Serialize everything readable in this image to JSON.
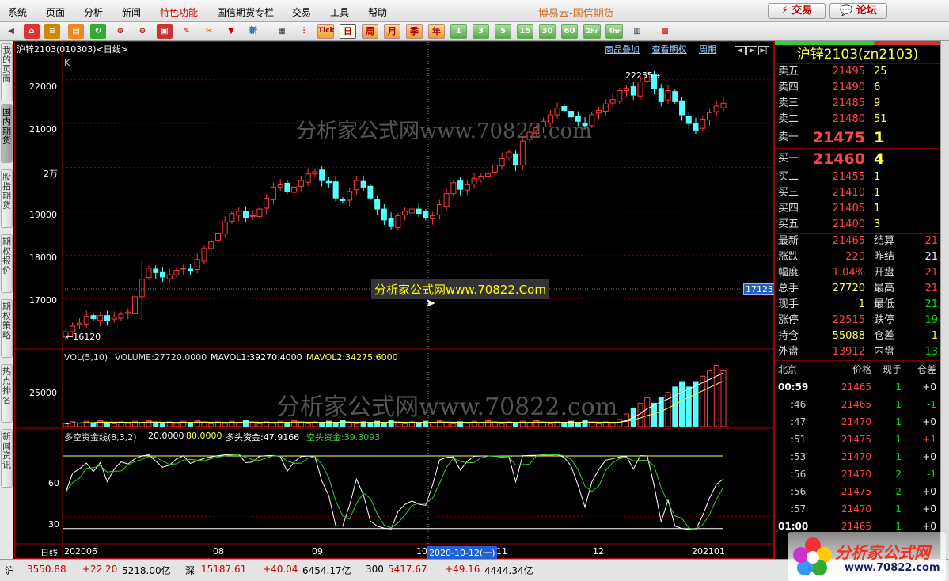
{
  "menu": {
    "items": [
      "系统",
      "页面",
      "分析",
      "新闻",
      "特色功能",
      "国信期货专栏",
      "交易",
      "工具",
      "帮助"
    ],
    "app_title": "博易云-国信期货",
    "trade_btn": "⚡ 交易",
    "forum_btn": "💬 论坛"
  },
  "toolbar": {
    "cycles": [
      "1",
      "3",
      "5",
      "15",
      "30",
      "60",
      "2hr",
      "4hr"
    ],
    "special": [
      "Tick",
      "日",
      "周",
      "月",
      "季",
      "年"
    ]
  },
  "left_tabs": [
    "我的页面",
    "国内期货",
    "股指期货",
    "期权报价",
    "期权策略",
    "热点排名",
    "新闻资讯"
  ],
  "chart": {
    "symbol_info": "沪锌2103(010303)<日线>",
    "k_label": "K",
    "links": [
      "商品叠加",
      "查看期权",
      "周期"
    ],
    "price_axis": [
      "22000",
      "21000",
      "2万",
      "19000",
      "18000",
      "17000"
    ],
    "high_label": "22255→",
    "low_label": "←16120",
    "cursor_price": "17123",
    "watermark": "分析家公式网www.70822.com",
    "tooltip": "分析家公式网www.70822.Com",
    "vol_header": {
      "title": "VOL(5,10)",
      "volume": "VOLUME:27720.0000",
      "mavol1": "MAVOL1:39270.4000",
      "mavol2": "MAVOL2:34275.6000"
    },
    "vol_axis": [
      "25000"
    ],
    "osc_header": {
      "title": "多空资金线(8,3,2)",
      "p1": "20.0000",
      "p2": "80.0000",
      "long": "多头资金:47.9166",
      "short": "空头资金:39.3093"
    },
    "osc_axis": [
      "60",
      "30"
    ],
    "date_axis": {
      "first": "日线",
      "labels": [
        "202006",
        "08",
        "09",
        "10",
        "11",
        "12",
        "202101"
      ],
      "highlight": "2020-10-12(一)"
    },
    "colors": {
      "up": "#ff3c3c",
      "down": "#54ffff",
      "ma1": "#ffffff",
      "ma2": "#ffff54",
      "osc_long": "#ffffff",
      "osc_short": "#3cc83c"
    }
  },
  "chart_data": {
    "type": "candlestick",
    "title": "沪锌2103(010303)<日线>",
    "price_high": 22255,
    "price_low": 16120,
    "ylim": [
      16000,
      22500
    ],
    "closes": [
      16250,
      16380,
      16450,
      16600,
      16550,
      16620,
      16500,
      16580,
      16650,
      16700,
      17050,
      17450,
      17700,
      17600,
      17500,
      17550,
      17650,
      17700,
      17650,
      17900,
      18150,
      18300,
      18500,
      18750,
      18950,
      19000,
      18850,
      18900,
      19050,
      19300,
      19550,
      19600,
      19450,
      19550,
      19700,
      19850,
      19900,
      19700,
      19650,
      19300,
      19250,
      19450,
      19700,
      19550,
      19300,
      19050,
      18800,
      18650,
      18900,
      19000,
      19050,
      18950,
      18850,
      18900,
      19150,
      19400,
      19650,
      19500,
      19600,
      19750,
      19800,
      19850,
      20050,
      20200,
      20350,
      20050,
      20600,
      20800,
      20900,
      21050,
      21200,
      21350,
      21300,
      21150,
      21050,
      20950,
      21200,
      21300,
      21450,
      21550,
      21750,
      21800,
      21650,
      21950,
      22150,
      21800,
      21500,
      21750,
      21500,
      21200,
      21000,
      20850,
      21100,
      21250,
      21400,
      21465
    ]
  },
  "quote": {
    "title": "沪锌2103(zn2103)",
    "asks": [
      {
        "label": "卖五",
        "price": "21495",
        "vol": "25"
      },
      {
        "label": "卖四",
        "price": "21490",
        "vol": "6"
      },
      {
        "label": "卖三",
        "price": "21485",
        "vol": "9"
      },
      {
        "label": "卖二",
        "price": "21480",
        "vol": "51"
      },
      {
        "label": "卖一",
        "price": "21475",
        "vol": "1"
      }
    ],
    "bids": [
      {
        "label": "买一",
        "price": "21460",
        "vol": "4"
      },
      {
        "label": "买二",
        "price": "21455",
        "vol": "1"
      },
      {
        "label": "买三",
        "price": "21410",
        "vol": "1"
      },
      {
        "label": "买四",
        "price": "21405",
        "vol": "1"
      },
      {
        "label": "买五",
        "price": "21400",
        "vol": "3"
      }
    ],
    "stats": [
      [
        "最新",
        "21465",
        "结算",
        "21"
      ],
      [
        "涨跌",
        "220",
        "昨结",
        "21"
      ],
      [
        "幅度",
        "1.04%",
        "开盘",
        "21"
      ],
      [
        "总手",
        "27720",
        "最高",
        "21"
      ],
      [
        "现手",
        "1",
        "最低",
        "21"
      ],
      [
        "涨停",
        "22515",
        "跌停",
        "19"
      ],
      [
        "持仓",
        "55088",
        "仓差",
        "1"
      ],
      [
        "外盘",
        "13912",
        "内盘",
        "13"
      ]
    ],
    "tick_header": [
      "北京",
      "价格",
      "现手",
      "仓差"
    ],
    "ticks": [
      [
        "00:59",
        "21465",
        "1",
        "+0"
      ],
      [
        ":46",
        "21465",
        "1",
        "-1"
      ],
      [
        ":47",
        "21470",
        "1",
        "+0"
      ],
      [
        ":51",
        "21475",
        "1",
        "+1"
      ],
      [
        ":53",
        "21470",
        "1",
        "+0"
      ],
      [
        ":56",
        "21470",
        "2",
        "-1"
      ],
      [
        ":56",
        "21475",
        "2",
        "+0"
      ],
      [
        ":57",
        "21470",
        "1",
        "+0"
      ],
      [
        "01:00",
        "21465",
        "1",
        "+0"
      ]
    ]
  },
  "status": {
    "sh_label": "沪",
    "sh_val": "3550.88",
    "sh_chg": "+22.20",
    "sh_amt": "5218.00亿",
    "sz_label": "深",
    "sz_val": "15187.61",
    "sz_chg": "+40.04",
    "sz_amt": "6454.17亿",
    "i300_label": "300",
    "i300_val": "5417.67",
    "i300_chg": "+49.16",
    "i300_amt": "4444.34亿"
  },
  "logo": {
    "text": "分析家公式网",
    "url": "www.70822.com"
  }
}
